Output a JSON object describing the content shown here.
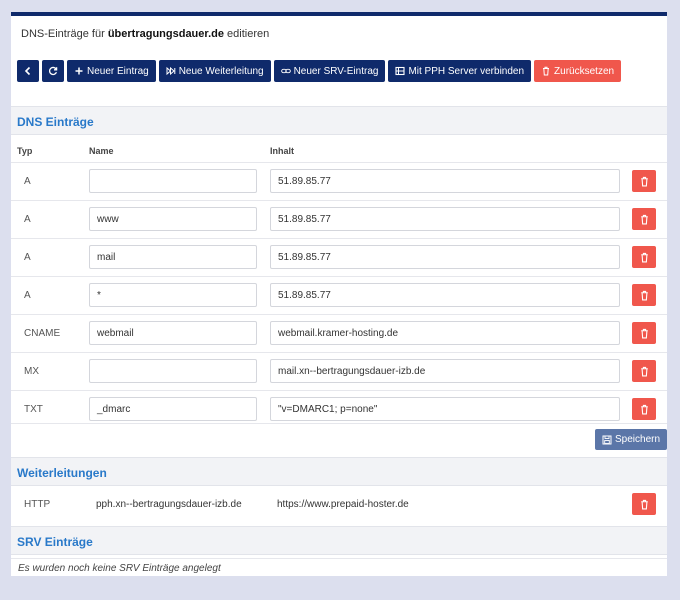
{
  "header": {
    "title_prefix": "DNS-Einträge für",
    "domain": "übertragungsdauer.de",
    "title_suffix": "editieren"
  },
  "toolbar": {
    "new_entry": "Neuer Eintrag",
    "new_redirect": "Neue Weiterleitung",
    "new_srv": "Neuer SRV-Eintrag",
    "connect_pph": "Mit PPH Server verbinden",
    "reset": "Zurücksetzen"
  },
  "dns": {
    "heading": "DNS Einträge",
    "columns": {
      "type": "Typ",
      "name": "Name",
      "content": "Inhalt"
    },
    "rows": [
      {
        "type": "A",
        "name": "",
        "content": "51.89.85.77"
      },
      {
        "type": "A",
        "name": "www",
        "content": "51.89.85.77"
      },
      {
        "type": "A",
        "name": "mail",
        "content": "51.89.85.77"
      },
      {
        "type": "A",
        "name": "*",
        "content": "51.89.85.77"
      },
      {
        "type": "CNAME",
        "name": "webmail",
        "content": "webmail.kramer-hosting.de"
      },
      {
        "type": "MX",
        "name": "",
        "content": "mail.xn--bertragungsdauer-izb.de"
      },
      {
        "type": "TXT",
        "name": "_dmarc",
        "content": "\"v=DMARC1; p=none\""
      }
    ],
    "save_label": "Speichern"
  },
  "redirects": {
    "heading": "Weiterleitungen",
    "rows": [
      {
        "type": "HTTP",
        "source": "pph.xn--bertragungsdauer-izb.de",
        "target": "https://www.prepaid-hoster.de"
      }
    ]
  },
  "srv": {
    "heading": "SRV Einträge",
    "empty_note": "Es wurden noch keine SRV Einträge angelegt"
  },
  "colors": {
    "primary": "#0f2a6b",
    "danger": "#f0574c",
    "heading": "#2979c9",
    "save": "#5b76a8"
  }
}
